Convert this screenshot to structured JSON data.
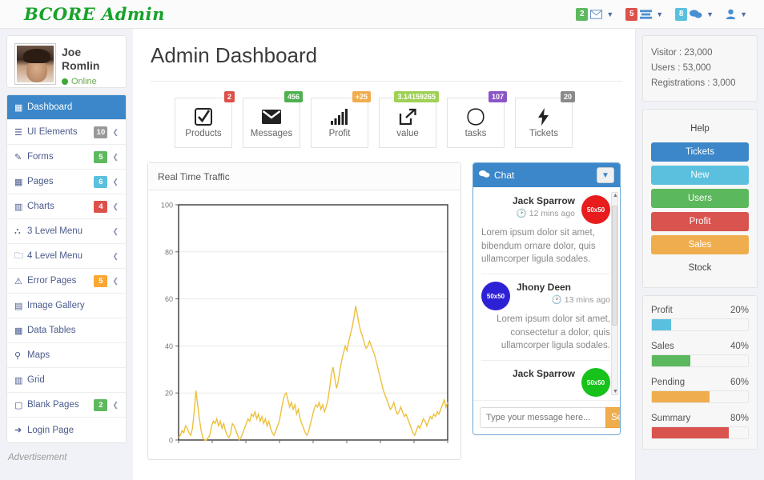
{
  "header": {
    "logo": "BCORE Admin",
    "groups": [
      {
        "badge": "2",
        "badge_color": "#5eb95e",
        "icon": "envelope-icon"
      },
      {
        "badge": "5",
        "badge_color": "#dd514c",
        "icon": "tasks-icon"
      },
      {
        "badge": "8",
        "badge_color": "#5bc0de",
        "icon": "chat-icon"
      },
      {
        "badge": "",
        "badge_color": "",
        "icon": "user-icon"
      }
    ]
  },
  "profile": {
    "name": "Joe Romlin",
    "status": "Online"
  },
  "sidebar": {
    "items": [
      {
        "label": "Dashboard",
        "icon": "grid-icon",
        "badge": "",
        "badge_class": "",
        "caret": false,
        "active": true
      },
      {
        "label": "UI Elements",
        "icon": "list-icon",
        "badge": "10",
        "badge_class": "b-gray",
        "caret": true,
        "active": false
      },
      {
        "label": "Forms",
        "icon": "pencil-icon",
        "badge": "5",
        "badge_class": "b-green",
        "caret": true,
        "active": false
      },
      {
        "label": "Pages",
        "icon": "grid-icon",
        "badge": "6",
        "badge_class": "b-cyan",
        "caret": true,
        "active": false
      },
      {
        "label": "Charts",
        "icon": "bar-chart-icon",
        "badge": "4",
        "badge_class": "b-red",
        "caret": true,
        "active": false
      },
      {
        "label": "3 Level Menu",
        "icon": "sitemap-icon",
        "badge": "",
        "badge_class": "",
        "caret": true,
        "active": false
      },
      {
        "label": "4 Level Menu",
        "icon": "folder-icon",
        "badge": "",
        "badge_class": "",
        "caret": true,
        "active": false
      },
      {
        "label": "Error Pages",
        "icon": "warning-icon",
        "badge": "5",
        "badge_class": "b-orange",
        "caret": true,
        "active": false
      },
      {
        "label": "Image Gallery",
        "icon": "film-icon",
        "badge": "",
        "badge_class": "",
        "caret": false,
        "active": false
      },
      {
        "label": "Data Tables",
        "icon": "table-icon",
        "badge": "",
        "badge_class": "",
        "caret": false,
        "active": false
      },
      {
        "label": "Maps",
        "icon": "map-pin-icon",
        "badge": "",
        "badge_class": "",
        "caret": false,
        "active": false
      },
      {
        "label": "Grid",
        "icon": "columns-icon",
        "badge": "",
        "badge_class": "",
        "caret": false,
        "active": false
      },
      {
        "label": "Blank Pages",
        "icon": "square-icon",
        "badge": "2",
        "badge_class": "b-green",
        "caret": true,
        "active": false
      },
      {
        "label": "Login Page",
        "icon": "signin-icon",
        "badge": "",
        "badge_class": "",
        "caret": false,
        "active": false
      }
    ],
    "advertisement_label": "Advertisement"
  },
  "main": {
    "page_title": "Admin Dashboard",
    "tiles": [
      {
        "label": "Products",
        "badge": "2",
        "badge_class": "tb-red",
        "icon": "check-square-icon"
      },
      {
        "label": "Messages",
        "badge": "456",
        "badge_class": "tb-green",
        "icon": "envelope-icon"
      },
      {
        "label": "Profit",
        "badge": "+25",
        "badge_class": "tb-orange",
        "icon": "signal-icon"
      },
      {
        "label": "value",
        "badge": "3.14159265",
        "badge_class": "tb-lgreen",
        "icon": "external-link-icon"
      },
      {
        "label": "tasks",
        "badge": "107",
        "badge_class": "tb-purple",
        "icon": "circle-outline-icon"
      },
      {
        "label": "Tickets",
        "badge": "20",
        "badge_class": "tb-gray",
        "icon": "bolt-icon"
      }
    ],
    "traffic_panel_title": "Real Time Traffic"
  },
  "chart_data": {
    "type": "line",
    "title": "Real Time Traffic",
    "xlabel": "",
    "ylabel": "",
    "ylim": [
      0,
      100
    ],
    "yticks": [
      0,
      20,
      40,
      60,
      80,
      100
    ],
    "grid": true,
    "line_color": "#edc03c",
    "series": [
      {
        "name": "Traffic",
        "values": [
          1,
          2,
          4,
          3,
          6,
          5,
          3,
          2,
          5,
          12,
          21,
          15,
          9,
          4,
          1,
          0,
          0,
          1,
          2,
          6,
          8,
          7,
          9,
          6,
          8,
          5,
          7,
          4,
          2,
          1,
          3,
          7,
          6,
          4,
          2,
          0,
          1,
          3,
          5,
          7,
          9,
          8,
          11,
          10,
          12,
          9,
          11,
          8,
          10,
          7,
          9,
          6,
          8,
          5,
          3,
          2,
          4,
          6,
          8,
          12,
          16,
          19,
          20,
          17,
          14,
          16,
          13,
          15,
          11,
          13,
          9,
          7,
          5,
          3,
          2,
          4,
          7,
          10,
          13,
          15,
          14,
          16,
          13,
          15,
          12,
          14,
          17,
          22,
          28,
          31,
          26,
          22,
          25,
          30,
          34,
          37,
          40,
          38,
          42,
          45,
          48,
          52,
          57,
          53,
          49,
          46,
          44,
          41,
          39,
          40,
          42,
          40,
          38,
          36,
          33,
          30,
          27,
          24,
          21,
          19,
          17,
          15,
          13,
          14,
          16,
          13,
          11,
          12,
          14,
          12,
          10,
          11,
          9,
          7,
          5,
          3,
          2,
          4,
          6,
          5,
          7,
          9,
          8,
          6,
          8,
          10,
          9,
          11,
          10,
          12,
          11,
          13,
          15,
          17,
          14,
          16
        ]
      }
    ]
  },
  "chat": {
    "title": "Chat",
    "messages": [
      {
        "name": "Jack Sparrow",
        "time": "12 mins ago",
        "text": "Lorem ipsum dolor sit amet, bibendum ornare dolor, quis ullamcorper ligula sodales.",
        "avatar_label": "50x50",
        "avatar_class": "av-red",
        "align": "right"
      },
      {
        "name": "Jhony Deen",
        "time": "13 mins ago",
        "text": "Lorem ipsum dolor sit amet, consectetur a dolor, quis ullamcorper ligula sodales.",
        "avatar_label": "50x50",
        "avatar_class": "av-blue",
        "align": "left"
      },
      {
        "name": "Jack Sparrow",
        "time": "",
        "text": "",
        "avatar_label": "50x50",
        "avatar_class": "av-green",
        "align": "right"
      }
    ],
    "input_placeholder": "Type your message here...",
    "send_label": "Send"
  },
  "rightbar": {
    "stats": [
      "Visitor  : 23,000",
      "Users  : 53,000",
      "Registrations  : 3,000"
    ],
    "buttons": [
      {
        "label": "Help",
        "class": "btn-default"
      },
      {
        "label": "Tickets",
        "class": "btn-primary"
      },
      {
        "label": "New",
        "class": "btn-info"
      },
      {
        "label": "Users",
        "class": "btn-success"
      },
      {
        "label": "Profit",
        "class": "btn-danger"
      },
      {
        "label": "Sales",
        "class": "btn-warning"
      },
      {
        "label": "Stock",
        "class": "btn-default"
      }
    ],
    "progress": [
      {
        "label": "Profit",
        "value": "20%",
        "pct": 20,
        "class": "pf-info"
      },
      {
        "label": "Sales",
        "value": "40%",
        "pct": 40,
        "class": "pf-success"
      },
      {
        "label": "Pending",
        "value": "60%",
        "pct": 60,
        "class": "pf-warning"
      },
      {
        "label": "Summary",
        "value": "80%",
        "pct": 80,
        "class": "pf-danger"
      }
    ]
  }
}
